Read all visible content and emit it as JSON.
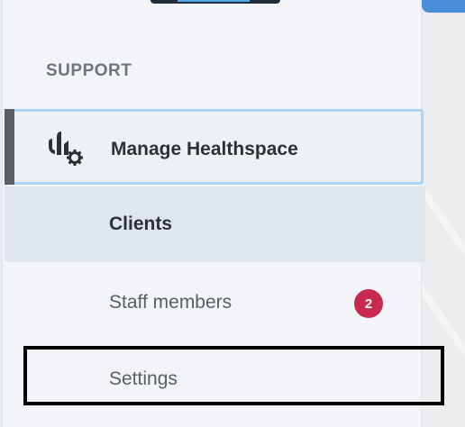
{
  "sidebar": {
    "section_heading": "SUPPORT",
    "parent_item": {
      "label": "Manage Healthspace",
      "icon": "manage-healthspace-icon"
    },
    "sub_items": [
      {
        "label": "Clients",
        "active": true
      },
      {
        "label": "Staff members",
        "badge": "2"
      },
      {
        "label": "Settings",
        "focused": true
      }
    ]
  },
  "colors": {
    "active_indicator": "#5b5f63",
    "selected_border": "#a9d4f5",
    "badge": "#c8294f",
    "focus_outline": "#000000",
    "accent_blue": "#4a90d9"
  }
}
